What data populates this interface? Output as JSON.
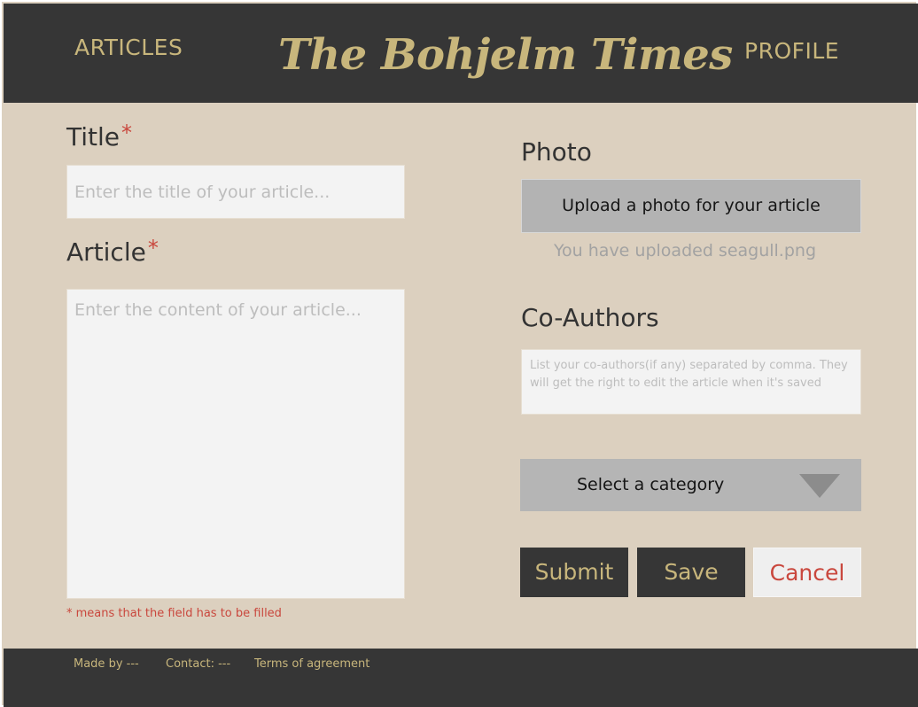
{
  "header": {
    "nav_articles": "ARTICLES",
    "brand": "The Bohjelm Times",
    "nav_profile": "PROFILE"
  },
  "form": {
    "title_label": "Title",
    "title_placeholder": "Enter the title of your article...",
    "article_label": "Article",
    "article_placeholder": "Enter the content of your article...",
    "required_marker": "*",
    "required_hint": "* means that the field has to be filled",
    "photo_label": "Photo",
    "upload_button": "Upload a photo for your article",
    "upload_status": "You have uploaded seagull.png",
    "coauthors_label": "Co-Authors",
    "coauthors_placeholder": "List your co-authors(if any) separated by comma. They will get the right to edit the article when it's saved",
    "category_select": "Select a category",
    "submit_button": "Submit",
    "save_button": "Save",
    "cancel_button": "Cancel"
  },
  "footer": {
    "made_by": "Made by ---",
    "contact": "Contact: ---",
    "terms": "Terms of agreement"
  },
  "colors": {
    "header_bg": "#363636",
    "page_bg": "#dcd0bf",
    "accent_gold": "#c8b67c",
    "required_red": "#c9473d",
    "input_bg": "#f3f3f3",
    "button_gray": "#b3b3b3"
  },
  "icons": {
    "category_dropdown": "chevron-down-triangle-icon"
  }
}
